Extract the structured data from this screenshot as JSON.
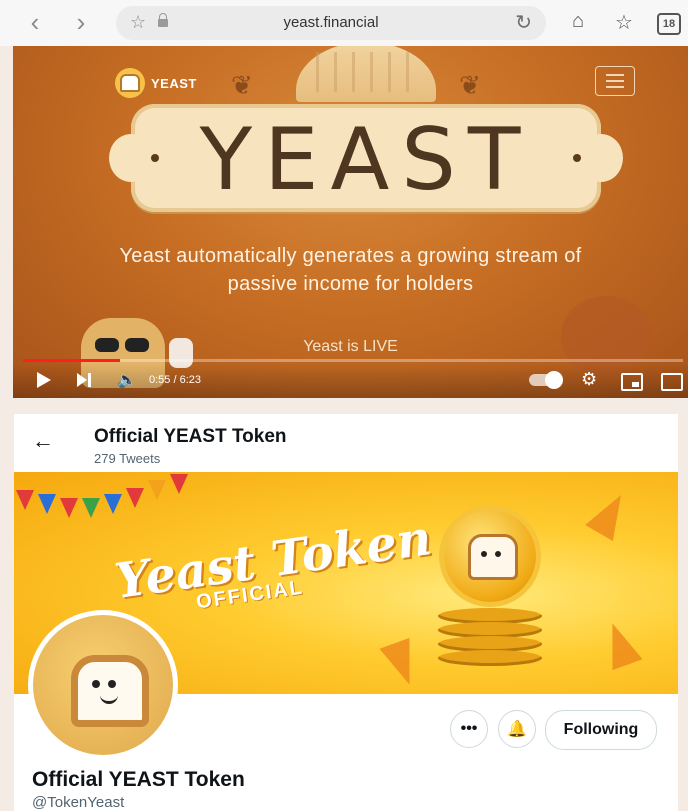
{
  "browser": {
    "url": "yeast.financial",
    "tab_count": "18"
  },
  "video": {
    "logo_text": "YEAST",
    "banner_title": "YEAST",
    "tagline_line1": "Yeast automatically generates a growing stream of",
    "tagline_line2": "passive income for holders",
    "subtitle": "Yeast is LIVE",
    "time_display": "0:55 / 6:23",
    "progress_fraction": 0.147,
    "progress_color": "#ff1f1f"
  },
  "twitter": {
    "header_name": "Official YEAST Token",
    "tweet_count": "279 Tweets",
    "banner_title_line1": "Yeast Token",
    "banner_title_line2": "OFFICIAL",
    "following_label": "Following",
    "more_label": "•••",
    "profile_name": "Official YEAST Token",
    "handle": "@TokenYeast"
  },
  "colors": {
    "video_bg": "#c66e24",
    "banner_bg": "#ffcb2e",
    "twitter_text": "#0f1419",
    "twitter_muted": "#536471"
  }
}
